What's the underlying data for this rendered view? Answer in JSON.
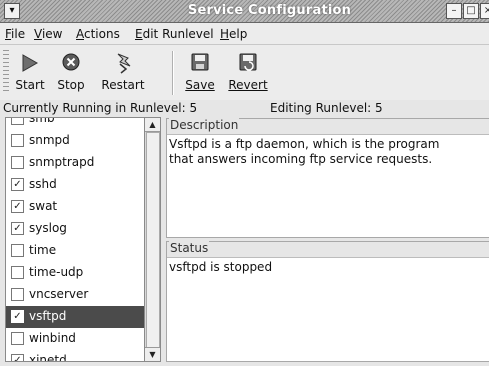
{
  "window": {
    "title": "Service Configuration"
  },
  "menubar": [
    {
      "pre": "",
      "ul": "F",
      "post": "ile"
    },
    {
      "pre": "",
      "ul": "V",
      "post": "iew"
    },
    {
      "pre": "",
      "ul": "A",
      "post": "ctions"
    },
    {
      "pre": "",
      "ul": "E",
      "post": "dit Runlevel"
    },
    {
      "pre": "",
      "ul": "H",
      "post": "elp"
    }
  ],
  "toolbar": {
    "start": "Start",
    "stop": "Stop",
    "restart": "Restart",
    "save": "Save",
    "revert": "Revert"
  },
  "statusline": {
    "running": "Currently Running in Runlevel: 5",
    "editing": "Editing Runlevel: 5"
  },
  "services": [
    {
      "name": "smb",
      "checked": false
    },
    {
      "name": "snmpd",
      "checked": false
    },
    {
      "name": "snmptrapd",
      "checked": false
    },
    {
      "name": "sshd",
      "checked": true
    },
    {
      "name": "swat",
      "checked": true
    },
    {
      "name": "syslog",
      "checked": true
    },
    {
      "name": "time",
      "checked": false
    },
    {
      "name": "time-udp",
      "checked": false
    },
    {
      "name": "vncserver",
      "checked": false
    },
    {
      "name": "vsftpd",
      "checked": true,
      "selected": true
    },
    {
      "name": "winbind",
      "checked": false
    },
    {
      "name": "xinetd",
      "checked": true
    }
  ],
  "description": {
    "label": "Description",
    "text": "Vsftpd is a ftp daemon, which is the program that answers incoming ftp service requests."
  },
  "status": {
    "label": "Status",
    "text": "vsftpd is stopped"
  }
}
